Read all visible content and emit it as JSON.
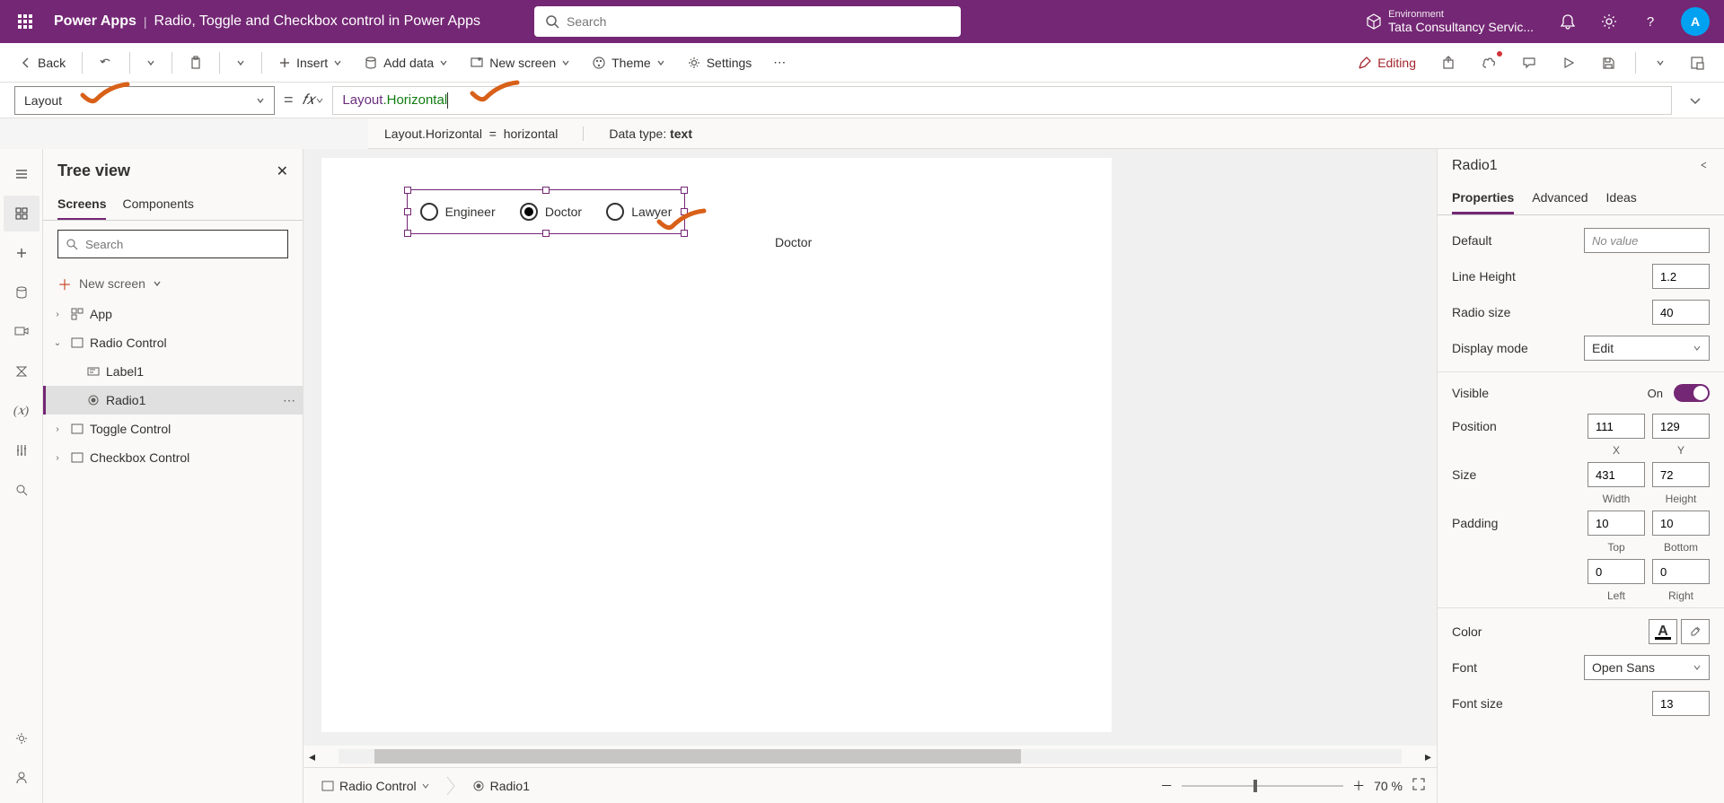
{
  "header": {
    "app": "Power Apps",
    "subtitle": "Radio, Toggle and Checkbox control in Power Apps",
    "search_placeholder": "Search",
    "env_label": "Environment",
    "env_name": "Tata Consultancy Servic...",
    "avatar_initial": "A"
  },
  "cmdbar": {
    "back": "Back",
    "insert": "Insert",
    "add_data": "Add data",
    "new_screen": "New screen",
    "theme": "Theme",
    "settings": "Settings",
    "editing": "Editing"
  },
  "formula": {
    "property": "Layout",
    "expr_prop": "Layout",
    "expr_val": ".Horizontal",
    "result_left": "Layout.Horizontal",
    "result_eq": "=",
    "result_val": "horizontal",
    "dtype_label": "Data type: ",
    "dtype_val": "text"
  },
  "tree": {
    "title": "Tree view",
    "tabs": {
      "screens": "Screens",
      "components": "Components"
    },
    "search_placeholder": "Search",
    "new_screen": "New screen",
    "items": {
      "app": "App",
      "radio_control": "Radio Control",
      "label1": "Label1",
      "radio1": "Radio1",
      "toggle_control": "Toggle Control",
      "checkbox_control": "Checkbox Control"
    }
  },
  "canvas": {
    "options": [
      "Engineer",
      "Doctor",
      "Lawyer"
    ],
    "selected_index": 1,
    "label_value": "Doctor",
    "breadcrumb_screen": "Radio Control",
    "breadcrumb_ctrl": "Radio1",
    "zoom": "70 %"
  },
  "props": {
    "title": "Radio1",
    "tabs": {
      "properties": "Properties",
      "advanced": "Advanced",
      "ideas": "Ideas"
    },
    "default_label": "Default",
    "default_val": "No value",
    "lineheight_label": "Line Height",
    "lineheight_val": "1.2",
    "radiosize_label": "Radio size",
    "radiosize_val": "40",
    "displaymode_label": "Display mode",
    "displaymode_val": "Edit",
    "visible_label": "Visible",
    "visible_on": "On",
    "position_label": "Position",
    "pos_x": "111",
    "pos_y": "129",
    "x_sub": "X",
    "y_sub": "Y",
    "size_label": "Size",
    "size_w": "431",
    "size_h": "72",
    "w_sub": "Width",
    "h_sub": "Height",
    "padding_label": "Padding",
    "pad_top": "10",
    "pad_bottom": "10",
    "top_sub": "Top",
    "bottom_sub": "Bottom",
    "pad_left": "0",
    "pad_right": "0",
    "left_sub": "Left",
    "right_sub": "Right",
    "color_label": "Color",
    "font_label": "Font",
    "font_val": "Open Sans",
    "fontsize_label": "Font size",
    "fontsize_val": "13"
  }
}
